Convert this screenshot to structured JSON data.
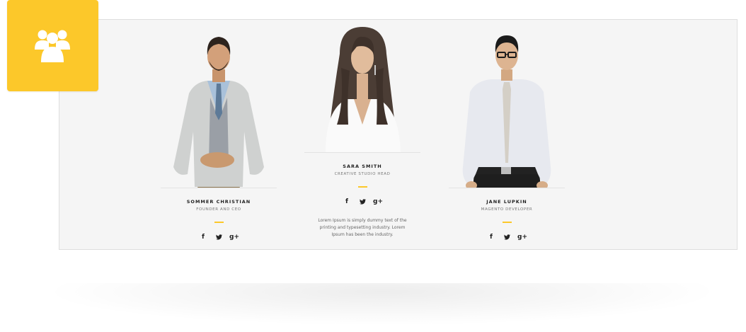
{
  "badge": {
    "icon": "users-icon",
    "color": "#fcc82a"
  },
  "accent_color": "#fcc82a",
  "members": [
    {
      "name": "SOMMER CHRISTIAN",
      "role": "FOUNDER AND CEO",
      "socials": {
        "facebook": "f",
        "twitter": "twitter-icon",
        "google": "g+"
      }
    },
    {
      "name": "SARA SMITH",
      "role": "CREATIVE STUDIO HEAD",
      "socials": {
        "facebook": "f",
        "twitter": "twitter-icon",
        "google": "g+"
      },
      "description": "Lorem Ipsum is simply dummy text of the printing and typesetting industry. Lorem Ipsum has been the industry."
    },
    {
      "name": "JANE LUPKIN",
      "role": "MAGENTO DEVELOPER",
      "socials": {
        "facebook": "f",
        "twitter": "twitter-icon",
        "google": "g+"
      }
    }
  ]
}
